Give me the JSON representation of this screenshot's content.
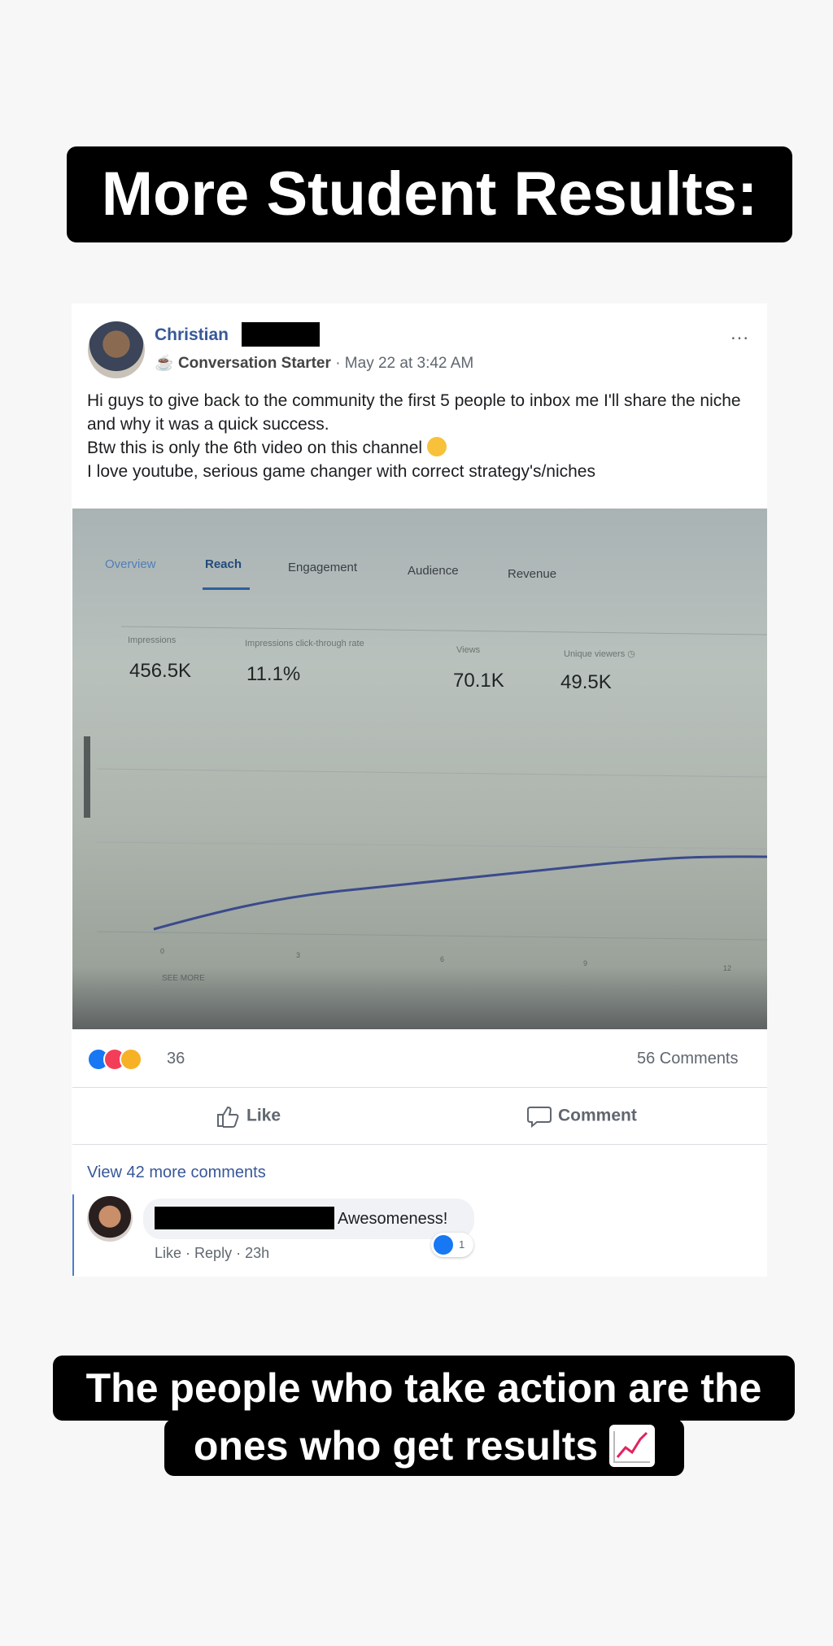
{
  "header_banner": {
    "text": "More Student Results:"
  },
  "post": {
    "author": "Christian",
    "badge": "Conversation Starter",
    "timestamp": "May 22 at 3:42 AM",
    "more_icon": "...",
    "body_lines": [
      "Hi guys to give back to the community the first 5 people to inbox me I'll share the niche and why it was a quick success.",
      "Btw this is only the 6th video on this channel",
      "I love youtube, serious game changer with correct strategy's/niches"
    ]
  },
  "analytics_photo": {
    "tabs": [
      "Overview",
      "Reach",
      "Engagement",
      "Audience",
      "Revenue"
    ],
    "active_tab": "Reach",
    "metrics": [
      {
        "label": "Impressions",
        "value": "456.5K"
      },
      {
        "label": "Impressions click-through rate",
        "value": "11.1%"
      },
      {
        "label": "Views",
        "value": "70.1K"
      },
      {
        "label": "Unique viewers",
        "value": "49.5K"
      }
    ],
    "x_ticks": [
      "0",
      "3",
      "6",
      "9",
      "12"
    ],
    "see_more": "SEE MORE",
    "line_color": "#3a4a8c"
  },
  "reactions": {
    "count": "36",
    "types": [
      "like",
      "love",
      "wow"
    ],
    "comments": "56 Comments"
  },
  "actions": {
    "like": "Like",
    "comment": "Comment"
  },
  "comments_section": {
    "view_more": "View 42 more comments",
    "comment": {
      "text": "Awesomeness!",
      "like_count": "1",
      "like_label": "Like",
      "reply_label": "Reply",
      "time": "23h"
    }
  },
  "footer_banner": {
    "line1": "The people who take action are the",
    "line2": "ones who get results"
  },
  "colors": {
    "link": "#385898",
    "banner": "#000000",
    "like_blue": "#1877f2"
  }
}
